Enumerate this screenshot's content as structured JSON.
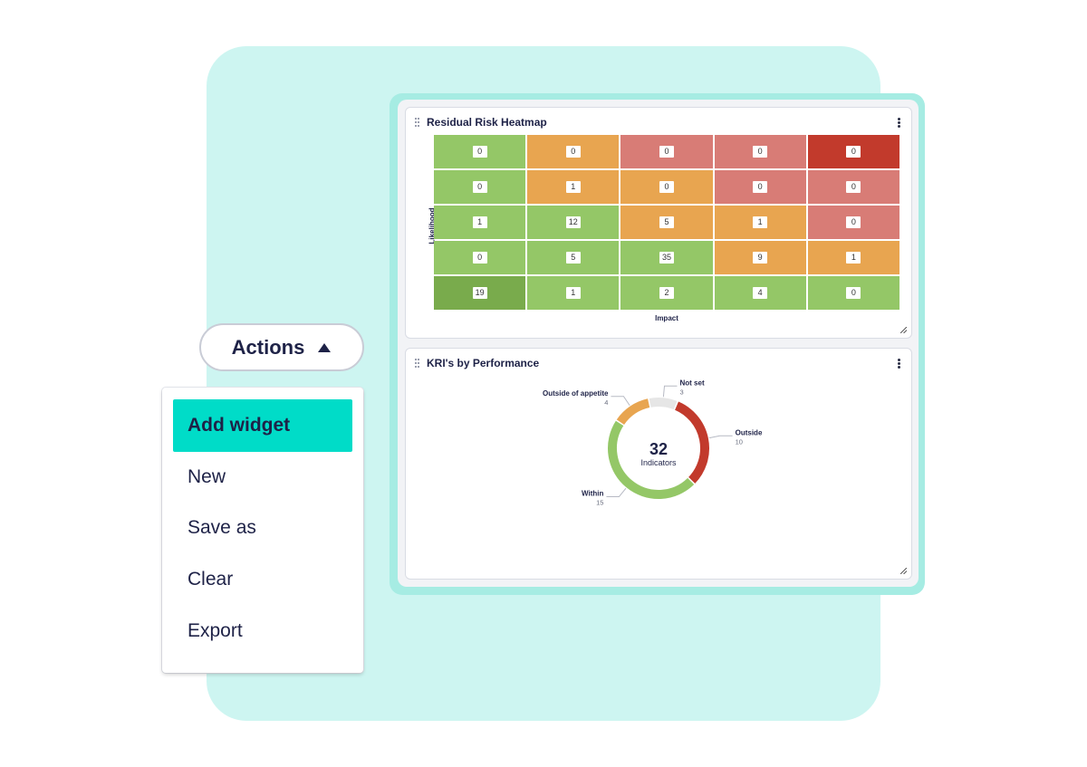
{
  "colors": {
    "background_panel": "#cdf5f1",
    "accent": "#00dcc8",
    "low": "#94c767",
    "low_dark": "#79ab4c",
    "medium": "#e8a550",
    "high": "#d87c76",
    "critical": "#c23a2c",
    "not_set": "#e6e6e6"
  },
  "heatmap_widget": {
    "title": "Residual Risk Heatmap",
    "menu_icon": "kebab-menu-icon",
    "drag_icon": "drag-handle-icon",
    "resize_icon": "resize-handle-icon"
  },
  "chart_data": [
    {
      "type": "heatmap",
      "title": "Residual Risk Heatmap",
      "xlabel": "Impact",
      "ylabel": "Likelihood",
      "rows": [
        {
          "values": [
            "0",
            "0",
            "0",
            "0",
            "0"
          ],
          "colors": [
            "low",
            "medium",
            "high",
            "high",
            "critical"
          ]
        },
        {
          "values": [
            "0",
            "1",
            "0",
            "0",
            "0"
          ],
          "colors": [
            "low",
            "medium",
            "medium",
            "high",
            "high"
          ]
        },
        {
          "values": [
            "1",
            "12",
            "5",
            "1",
            "0"
          ],
          "colors": [
            "low",
            "low",
            "medium",
            "medium",
            "high"
          ]
        },
        {
          "values": [
            "0",
            "5",
            "35",
            "9",
            "1"
          ],
          "colors": [
            "low",
            "low",
            "low",
            "medium",
            "medium"
          ]
        },
        {
          "values": [
            "19",
            "1",
            "2",
            "4",
            "0"
          ],
          "colors": [
            "low_dark",
            "low",
            "low",
            "low",
            "low"
          ]
        }
      ]
    },
    {
      "type": "pie",
      "title": "KRI's by Performance",
      "center_value": "32",
      "center_label": "Indicators",
      "slices": [
        {
          "name": "Not set",
          "value": 3,
          "label": "3",
          "color": "not_set"
        },
        {
          "name": "Outside",
          "value": 10,
          "label": "10",
          "color": "critical"
        },
        {
          "name": "Within",
          "value": 15,
          "label": "15",
          "color": "low"
        },
        {
          "name": "Outside of appetite",
          "value": 4,
          "label": "4",
          "color": "medium"
        }
      ]
    }
  ],
  "kri_widget": {
    "title": "KRI's by Performance"
  },
  "actions": {
    "label": "Actions",
    "icon": "caret-up-icon",
    "menu": [
      {
        "label": "Add widget",
        "active": true
      },
      {
        "label": "New",
        "active": false
      },
      {
        "label": "Save as",
        "active": false
      },
      {
        "label": "Clear",
        "active": false
      },
      {
        "label": "Export",
        "active": false
      }
    ]
  }
}
